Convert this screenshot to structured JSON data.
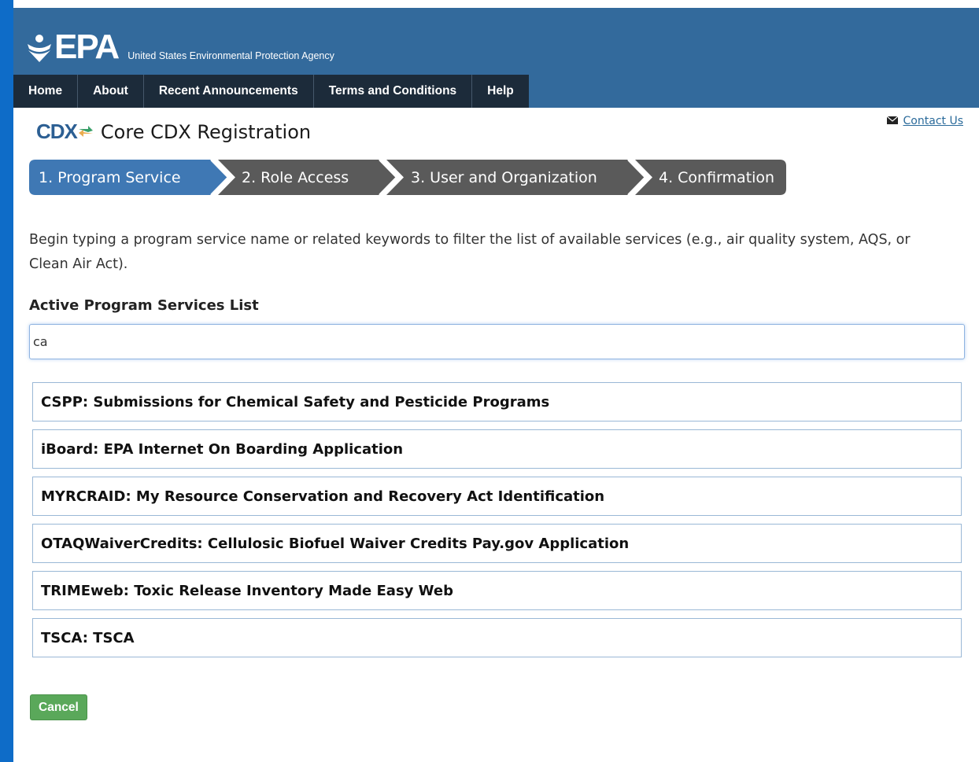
{
  "header": {
    "logo_text": "EPA",
    "agency_name": "United States Environmental Protection Agency",
    "nav": [
      {
        "label": "Home"
      },
      {
        "label": "About"
      },
      {
        "label": "Recent Announcements"
      },
      {
        "label": "Terms and Conditions"
      },
      {
        "label": "Help"
      }
    ]
  },
  "contact": {
    "label": "Contact Us",
    "icon": "envelope-icon"
  },
  "page": {
    "cdx_logo": "CDX",
    "title": "Core CDX Registration"
  },
  "steps": [
    {
      "label": "1. Program Service",
      "active": true
    },
    {
      "label": "2. Role Access",
      "active": false
    },
    {
      "label": "3. User and Organization",
      "active": false
    },
    {
      "label": "4. Confirmation",
      "active": false
    }
  ],
  "intro_text": "Begin typing a program service name or related keywords to filter the list of available services (e.g., air quality system, AQS, or Clean Air Act).",
  "list": {
    "heading": "Active Program Services List",
    "search_value": "ca",
    "items": [
      {
        "label": "CSPP: Submissions for Chemical Safety and Pesticide Programs"
      },
      {
        "label": "iBoard: EPA Internet On Boarding Application"
      },
      {
        "label": "MYRCRAID: My Resource Conservation and Recovery Act Identification"
      },
      {
        "label": "OTAQWaiverCredits: Cellulosic Biofuel Waiver Credits Pay.gov Application"
      },
      {
        "label": "TRIMEweb: Toxic Release Inventory Made Easy Web"
      },
      {
        "label": "TSCA: TSCA"
      }
    ]
  },
  "cancel_label": "Cancel",
  "colors": {
    "header_bg": "#336a9c",
    "nav_bg": "#1c2b3a",
    "step_active": "#3f78b4",
    "step_inactive": "#5a5a5a",
    "cancel_bg": "#5aa85a"
  }
}
